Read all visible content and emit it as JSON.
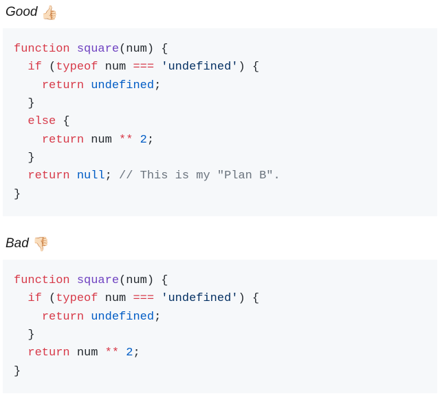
{
  "good": {
    "label": "Good",
    "emoji": "👍🏻",
    "code": {
      "kw_function": "function",
      "fn_name": "square",
      "param": "num",
      "kw_if": "if",
      "kw_typeof": "typeof",
      "var_num": "num",
      "op_eq": "===",
      "str_undef": "'undefined'",
      "kw_return1": "return",
      "val_undef": "undefined",
      "kw_else": "else",
      "kw_return2": "return",
      "var_num2": "num",
      "op_pow": "**",
      "num_two": "2",
      "kw_return3": "return",
      "val_null": "null",
      "comment": "// This is my \"Plan B\"."
    }
  },
  "bad": {
    "label": "Bad",
    "emoji": "👎🏻",
    "code": {
      "kw_function": "function",
      "fn_name": "square",
      "param": "num",
      "kw_if": "if",
      "kw_typeof": "typeof",
      "var_num": "num",
      "op_eq": "===",
      "str_undef": "'undefined'",
      "kw_return1": "return",
      "val_undef": "undefined",
      "kw_return2": "return",
      "var_num2": "num",
      "op_pow": "**",
      "num_two": "2"
    }
  }
}
